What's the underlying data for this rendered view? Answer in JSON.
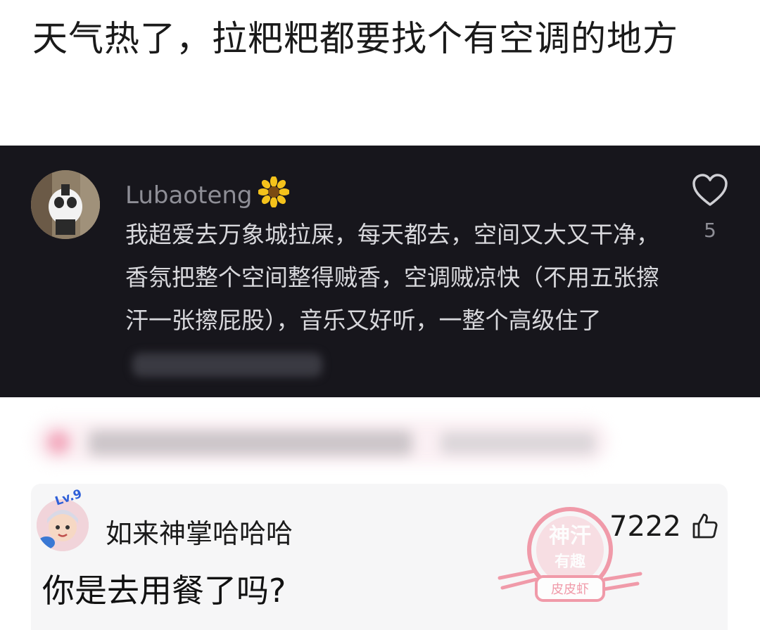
{
  "post": {
    "title": "天气热了，拉粑粑都要找个有空调的地方"
  },
  "quoted_comment": {
    "username": "Lubaoteng",
    "username_badge": "sunflower-icon",
    "text": "我超爱去万象城拉屎，每天都去，空间又大又干净，香氛把整个空间整得贼香，空调贼凉快（不用五张擦汗一张擦屁股），音乐又好听，一整个高级住了",
    "like_count": "5",
    "theme": {
      "background": "#17161c",
      "text": "#d8d8dc",
      "muted": "#8e8e96"
    }
  },
  "hot_comment": {
    "level_badge": "Lv.9",
    "username": "如来神掌哈哈哈",
    "text": "你是去用餐了吗?",
    "like_count": "7222"
  },
  "watermark": {
    "line1": "神汗",
    "line2": "有趣",
    "line3": "皮皮虾",
    "color": "#f08a9c"
  }
}
